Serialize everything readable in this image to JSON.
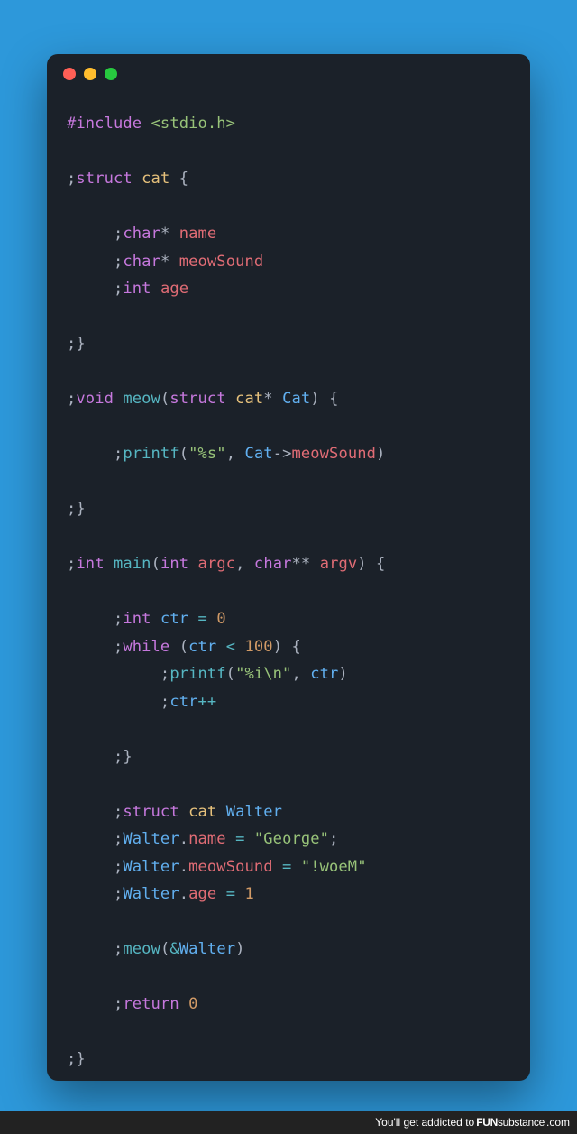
{
  "window": {
    "buttons": [
      "close",
      "minimize",
      "zoom"
    ]
  },
  "code": {
    "l1_preproc": "#include ",
    "l1_header": "<stdio.h>",
    "l3_semi": ";",
    "l3_struct": "struct",
    "l3_cat": " cat ",
    "l3_brace": "{",
    "l5_indent": "     ;",
    "l5_char": "char",
    "l5_star": "* ",
    "l5_name": "name",
    "l6_indent": "     ;",
    "l6_char": "char",
    "l6_star": "* ",
    "l6_meow": "meowSound",
    "l7_indent": "     ;",
    "l7_int": "int",
    "l7_age": " age",
    "l9_close": ";}",
    "l11_semi": ";",
    "l11_void": "void",
    "l11_meow": " meow",
    "l11_paren": "(",
    "l11_struct": "struct",
    "l11_cat": " cat",
    "l11_star": "* ",
    "l11_Cat": "Cat",
    "l11_end": ") {",
    "l13_indent": "     ;",
    "l13_printf": "printf",
    "l13_lp": "(",
    "l13_str": "\"%s\"",
    "l13_comma": ", ",
    "l13_Cat": "Cat",
    "l13_arrow": "->",
    "l13_ms": "meowSound",
    "l13_rp": ")",
    "l15_close": ";}",
    "l17_semi": ";",
    "l17_int": "int",
    "l17_main": " main",
    "l17_lp": "(",
    "l17_int2": "int",
    "l17_argc": " argc",
    "l17_comma": ", ",
    "l17_char": "char",
    "l17_ss": "** ",
    "l17_argv": "argv",
    "l17_rp": ") {",
    "l19_indent": "     ;",
    "l19_int": "int",
    "l19_ctr": " ctr ",
    "l19_eq": "= ",
    "l19_zero": "0",
    "l20_indent": "     ;",
    "l20_while": "while",
    "l20_lp": " (",
    "l20_ctr": "ctr ",
    "l20_lt": "< ",
    "l20_100": "100",
    "l20_rp": ") {",
    "l21_indent": "          ;",
    "l21_printf": "printf",
    "l21_lp": "(",
    "l21_str": "\"%i\\n\"",
    "l21_comma": ", ",
    "l21_ctr": "ctr",
    "l21_rp": ")",
    "l22_indent": "          ;",
    "l22_ctr": "ctr",
    "l22_pp": "++",
    "l24_close": "     ;}",
    "l26_indent": "     ;",
    "l26_struct": "struct",
    "l26_cat": " cat ",
    "l26_Walter": "Walter",
    "l27_indent": "     ;",
    "l27_Walter": "Walter",
    "l27_dot": ".",
    "l27_name": "name",
    "l27_eq": " = ",
    "l27_str": "\"George\"",
    "l27_semi2": ";",
    "l28_indent": "     ;",
    "l28_Walter": "Walter",
    "l28_dot": ".",
    "l28_ms": "meowSound",
    "l28_eq": " = ",
    "l28_str": "\"!woeM\"",
    "l29_indent": "     ;",
    "l29_Walter": "Walter",
    "l29_dot": ".",
    "l29_age": "age",
    "l29_eq": " = ",
    "l29_one": "1",
    "l31_indent": "     ;",
    "l31_meow": "meow",
    "l31_lp": "(",
    "l31_amp": "&",
    "l31_Walter": "Walter",
    "l31_rp": ")",
    "l33_indent": "     ;",
    "l33_return": "return",
    "l33_zero": " 0",
    "l35_close": ";}"
  },
  "footer": {
    "pre": "You'll get addicted to ",
    "brand": "FUN",
    "brand2": "substance",
    "post": ".com"
  }
}
